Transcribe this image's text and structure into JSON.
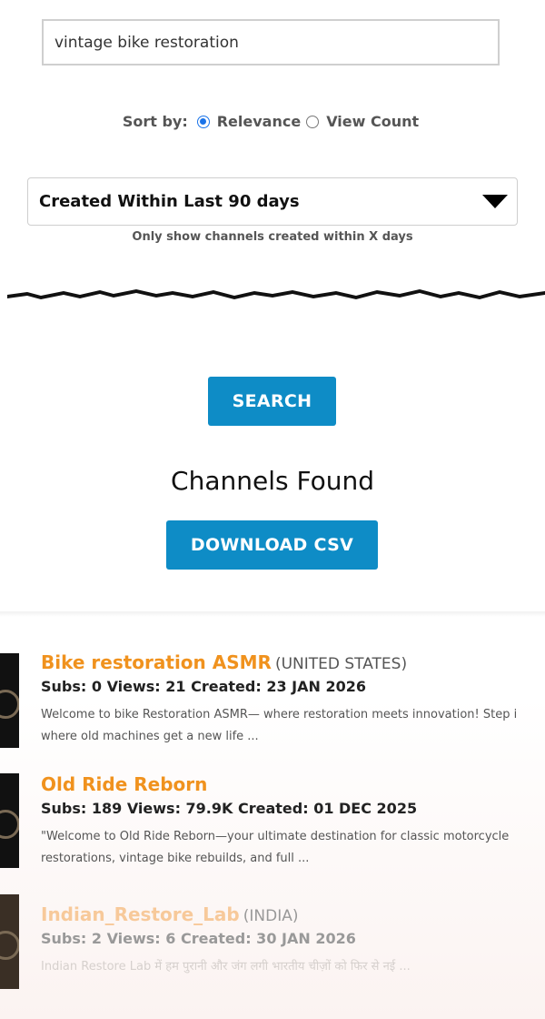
{
  "search": {
    "query": "vintage bike restoration"
  },
  "sort": {
    "label": "Sort by:",
    "options": [
      {
        "label": "Relevance",
        "selected": true
      },
      {
        "label": "View Count",
        "selected": false
      }
    ]
  },
  "filter": {
    "selected": "Created Within Last 90 days",
    "hint": "Only show channels created within X days"
  },
  "buttons": {
    "search": "SEARCH",
    "download": "DOWNLOAD CSV"
  },
  "results_heading": "Channels Found",
  "colors": {
    "accent_blue": "#0e8cc6",
    "channel_orange": "#f0921e",
    "radio_blue": "#1a73e8"
  },
  "channels": [
    {
      "name": "Bike restoration ASMR",
      "country": "(UNITED STATES)",
      "stats": "Subs: 0 Views: 21 Created: 23 JAN 2026",
      "desc1": "Welcome to bike Restoration ASMR— where restoration meets innovation! Step i",
      "desc2": "where old machines get a new life ..."
    },
    {
      "name": "Old Ride Reborn",
      "country": "",
      "stats": "Subs: 189 Views: 79.9K Created: 01 DEC 2025",
      "desc1": "\"Welcome to Old Ride Reborn—your ultimate destination for classic motorcycle",
      "desc2": "restorations, vintage bike rebuilds, and full ..."
    },
    {
      "name": "Indian_Restore_Lab",
      "country": "(INDIA)",
      "stats": "Subs: 2 Views: 6 Created: 30 JAN 2026",
      "desc1": "Indian Restore Lab में हम पुरानी और जंग लगी भारतीय चीज़ों को फिर से नई ...",
      "desc2": ""
    }
  ]
}
